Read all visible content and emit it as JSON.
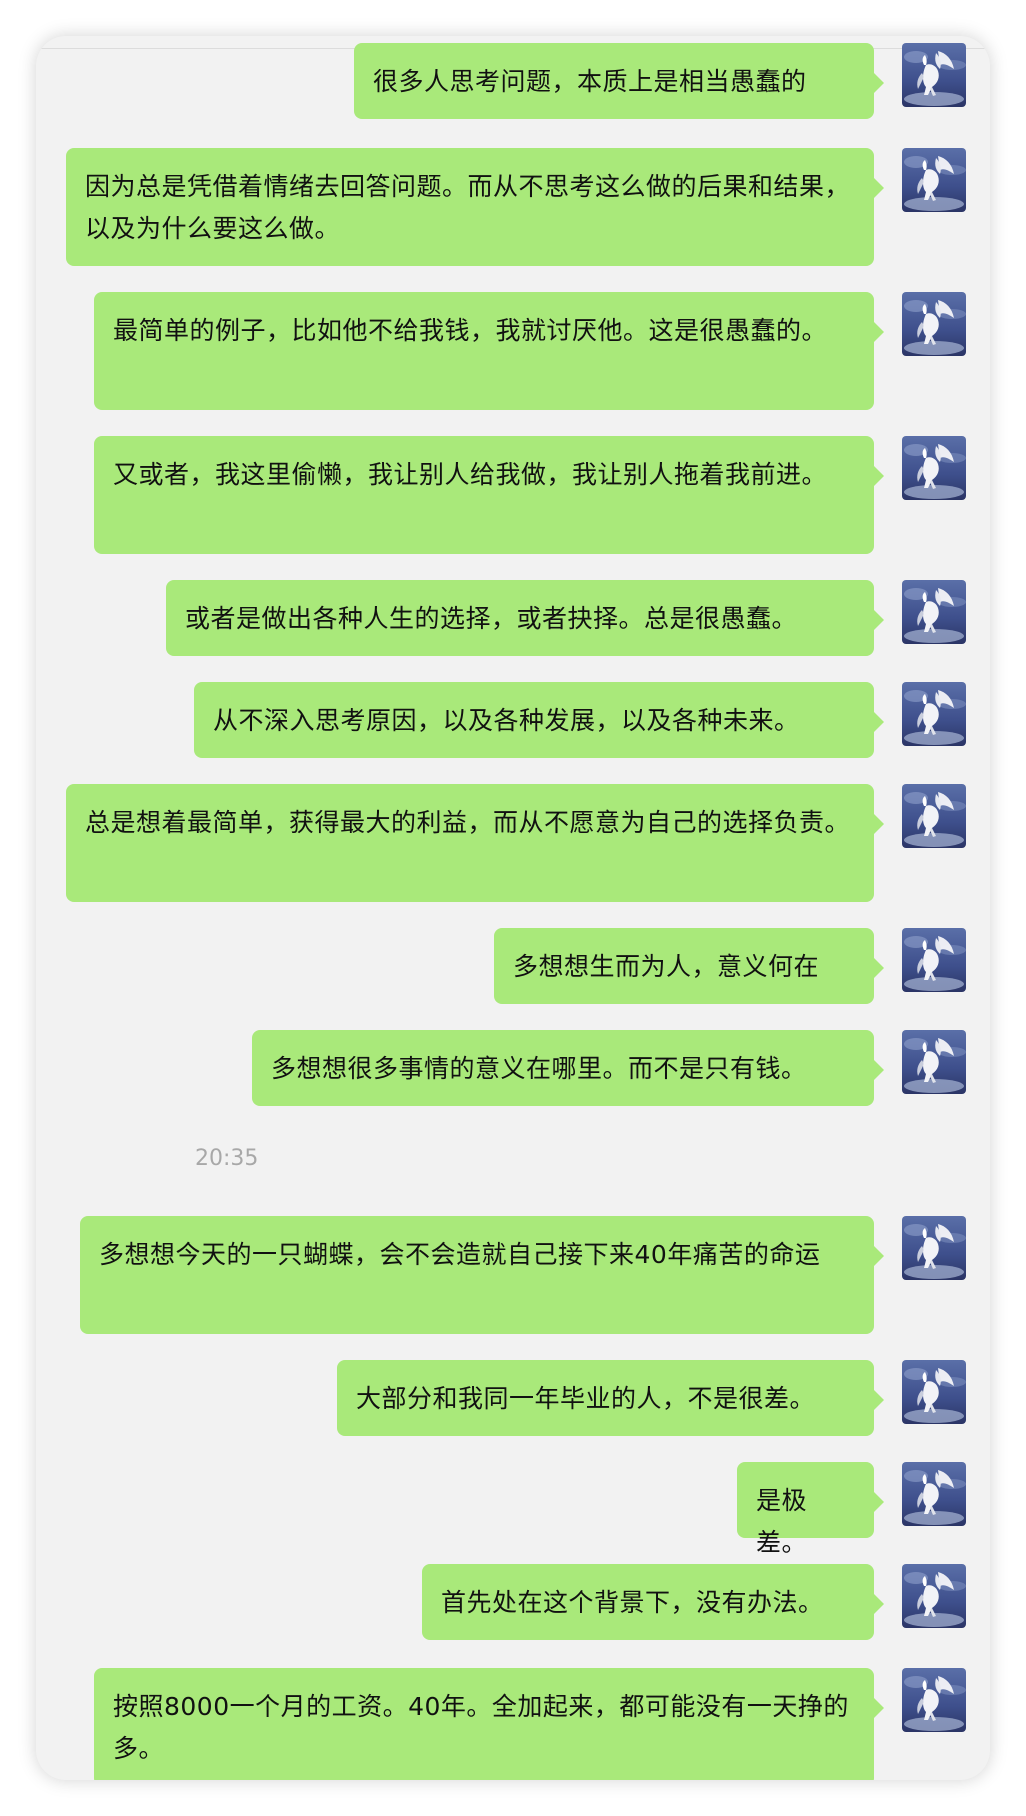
{
  "chat": {
    "messages": [
      {
        "text": "很多人思考问题，本质上是相当愚蠢的"
      },
      {
        "text": "因为总是凭借着情绪去回答问题。而从不思考这么做的后果和结果，以及为什么要这么做。"
      },
      {
        "text": "最简单的例子，比如他不给我钱，我就讨厌他。这是很愚蠢的。"
      },
      {
        "text": "又或者，我这里偷懒，我让别人给我做，我让别人拖着我前进。"
      },
      {
        "text": "或者是做出各种人生的选择，或者抉择。总是很愚蠢。"
      },
      {
        "text": "从不深入思考原因，以及各种发展，以及各种未来。"
      },
      {
        "text": "总是想着最简单，获得最大的利益，而从不愿意为自己的选择负责。"
      },
      {
        "text": "多想想生而为人，意义何在"
      },
      {
        "text": "多想想很多事情的意义在哪里。而不是只有钱。"
      },
      {
        "text": "多想想今天的一只蝴蝶，会不会造就自己接下来40年痛苦的命运"
      },
      {
        "text": "大部分和我同一年毕业的人，不是很差。"
      },
      {
        "text": "是极差。"
      },
      {
        "text": "首先处在这个背景下，没有办法。"
      },
      {
        "text": "按照8000一个月的工资。40年。全加起来，都可能没有一天挣的多。"
      }
    ],
    "timestamp": "20:35"
  },
  "colors": {
    "bubble": "#a9e97a",
    "background": "#f2f2f2",
    "timestamp_text": "#a8a8a8"
  },
  "icons": {
    "avatar": "pegasus-avatar-icon"
  }
}
